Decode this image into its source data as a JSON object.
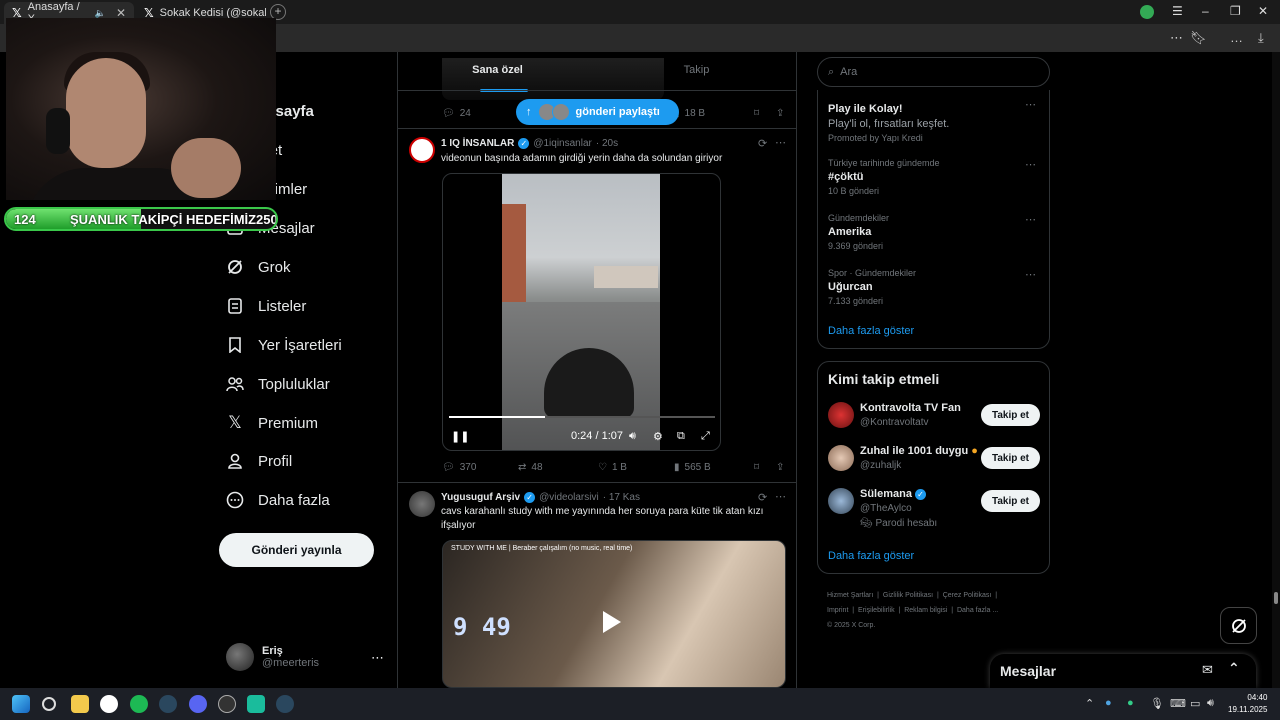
{
  "browser": {
    "tabs": [
      {
        "label": "Anasayfa / X",
        "active": true
      },
      {
        "label": "Sokak Kedisi (@sokakkedi",
        "active": false
      }
    ]
  },
  "overlay": {
    "goal_label": "ŞUANLIK TAKİPÇİ HEDEFİMİZ",
    "goal_current": "124",
    "goal_target": "250",
    "goal_progress": 0.5
  },
  "nav": {
    "items": [
      {
        "label": "nasayfa",
        "icon": "home-icon"
      },
      {
        "label": "şfet",
        "icon": "search-icon"
      },
      {
        "label": "dirimler",
        "icon": "bell-icon"
      },
      {
        "label": "Mesajlar",
        "icon": "mail-icon"
      },
      {
        "label": "Grok",
        "icon": "grok-icon"
      },
      {
        "label": "Listeler",
        "icon": "list-icon"
      },
      {
        "label": "Yer İşaretleri",
        "icon": "bookmark-icon"
      },
      {
        "label": "Topluluklar",
        "icon": "communities-icon"
      },
      {
        "label": "Premium",
        "icon": "x-logo-icon"
      },
      {
        "label": "Profil",
        "icon": "person-icon"
      },
      {
        "label": "Daha fazla",
        "icon": "more-circle-icon"
      }
    ],
    "post_button": "Gönderi yayınla",
    "profile": {
      "name": "Eriş",
      "handle": "@meerteris"
    }
  },
  "feed": {
    "tabs": [
      "Sana özel",
      "Takip"
    ],
    "share_pill": "gönderi paylaştı",
    "prev_actions": {
      "replies": "24",
      "views": "18 B"
    },
    "tweet1": {
      "name": "1 IQ İNSANLAR",
      "handle": "@1iqinsanlar",
      "time": "· 20s",
      "text": "videonun başında adamın girdiği yerin daha da solundan giriyor",
      "video_time": "0:24 / 1:07",
      "video_progress": 0.36,
      "replies": "370",
      "reposts": "48",
      "likes": "1 B",
      "views": "565 B"
    },
    "tweet2": {
      "name": "Yugusuguf Arşiv",
      "handle": "@videolarsivi",
      "time": "· 17 Kas",
      "text": "cavs karahanlı study with me yayınında her soruya para küte tik atan kızı ifşalıyor",
      "card_title": "STUDY WITH ME | Beraber çalışalım (no music, real time)",
      "card_clock": "9 49"
    }
  },
  "sidebar": {
    "search_placeholder": "Ara",
    "promo": {
      "title": "Play ile Kolay!",
      "subtitle": "Play'li ol, fırsatları keşfet.",
      "promoted": "Promoted by Yapı Kredi"
    },
    "trends": [
      {
        "context": "Türkiye tarihinde gündemde",
        "title": "#çöktü",
        "count": "10 B gönderi"
      },
      {
        "context": "Gündemdekiler",
        "title": "Amerika",
        "count": "9.369 gönderi"
      },
      {
        "context": "Spor · Gündemdekiler",
        "title": "Uğurcan",
        "count": "7.133 gönderi"
      }
    ],
    "show_more": "Daha fazla göster",
    "who_to_follow_title": "Kimi takip etmeli",
    "suggestions": [
      {
        "name": "Kontravolta TV Fan",
        "handle": "@Kontravoltatv",
        "button": "Takip et",
        "note": ""
      },
      {
        "name": "Zuhal ile 1001 duygu",
        "handle": "@zuhaljk",
        "button": "Takip et",
        "note": ""
      },
      {
        "name": "Sülemana",
        "handle": "@TheAylco",
        "button": "Takip et",
        "note": "Parodi hesabı"
      }
    ],
    "show_more_2": "Daha fazla göster",
    "footer": [
      "Hizmet Şartları",
      "Gizlilik Politikası",
      "Çerez Politikası",
      "Imprint",
      "Erişilebilirlik",
      "Reklam bilgisi",
      "Daha fazla ...",
      "© 2025 X Corp."
    ]
  },
  "messages_drawer": "Mesajlar",
  "taskbar": {
    "time": "04:40",
    "date": "19.11.2025"
  },
  "colors": {
    "accent": "#1d9bf0",
    "goal_green": "#3ac74a"
  }
}
